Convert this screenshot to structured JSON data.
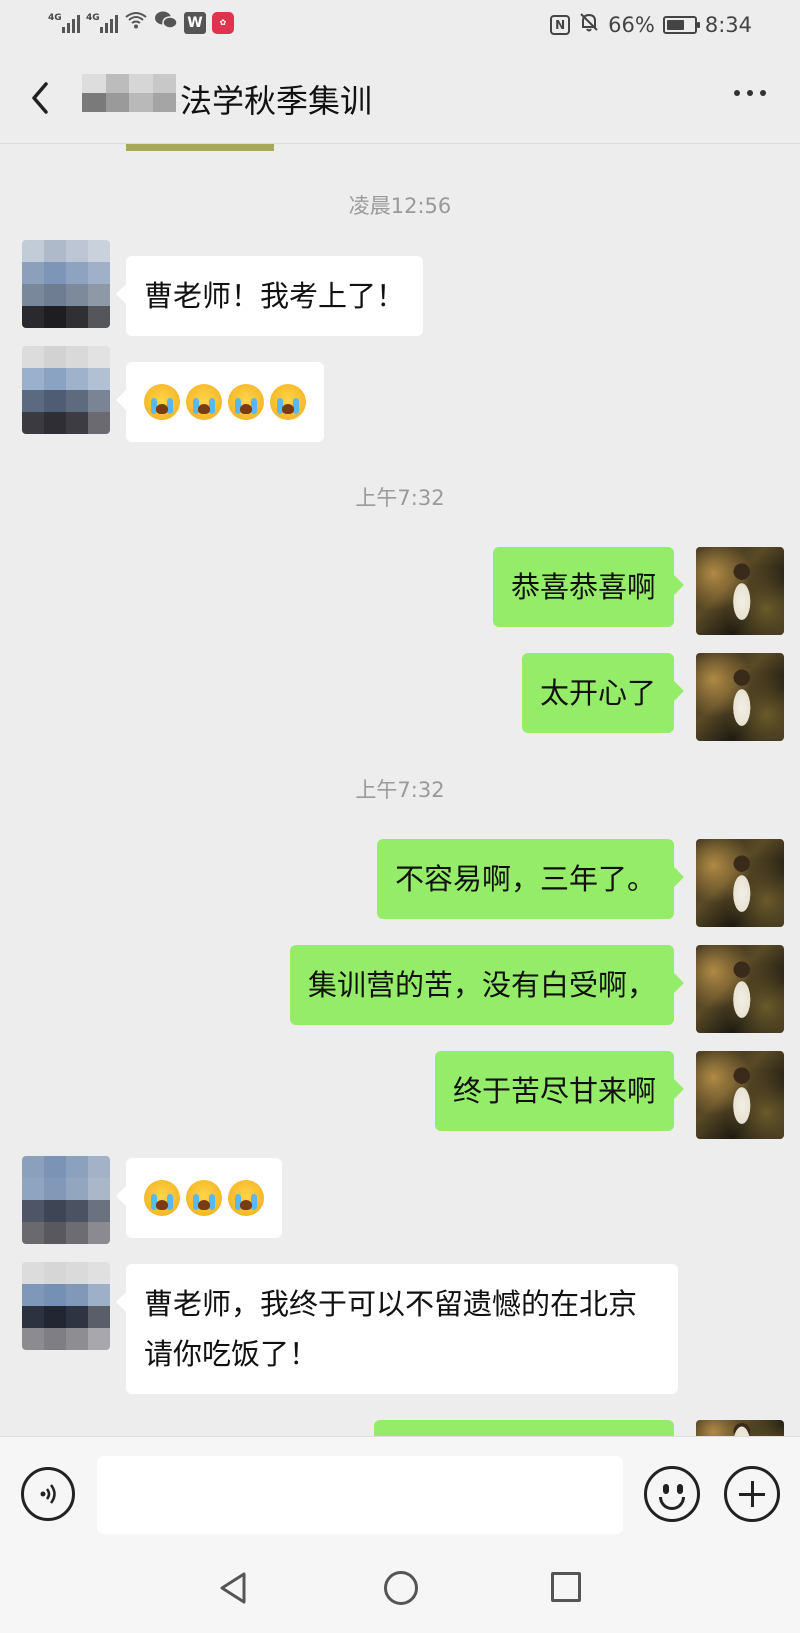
{
  "status_bar": {
    "net1": "4G",
    "net2": "4G",
    "battery_text": "66%",
    "battery_level": 0.66,
    "time": "8:34",
    "icons": [
      "signal-icon",
      "wifi-icon",
      "wechat-icon",
      "wps-icon",
      "huawei-icon",
      "nfc-icon",
      "mute-bell-icon",
      "battery-icon"
    ]
  },
  "header": {
    "title": "法学秋季集训",
    "title_prefix_blurred": true
  },
  "messages": {
    "ts1": "凌晨12:56",
    "m1": "曹老师！我考上了！",
    "m2_emoji_count": 4,
    "ts2": "上午7:32",
    "m3": "恭喜恭喜啊",
    "m4": "太开心了",
    "ts3": "上午7:32",
    "m5": "不容易啊，三年了。",
    "m6": "集训营的苦，没有白受啊，",
    "m7": "终于苦尽甘来啊",
    "m8_emoji_count": 3,
    "m9": "曹老师，我终于可以不留遗憾的在北京请你吃饭了！"
  },
  "input": {
    "value": "",
    "placeholder": ""
  },
  "colors": {
    "background": "#ededed",
    "outgoing_bubble": "#95ec69",
    "incoming_bubble": "#ffffff",
    "timestamp": "#9a9a9a"
  }
}
